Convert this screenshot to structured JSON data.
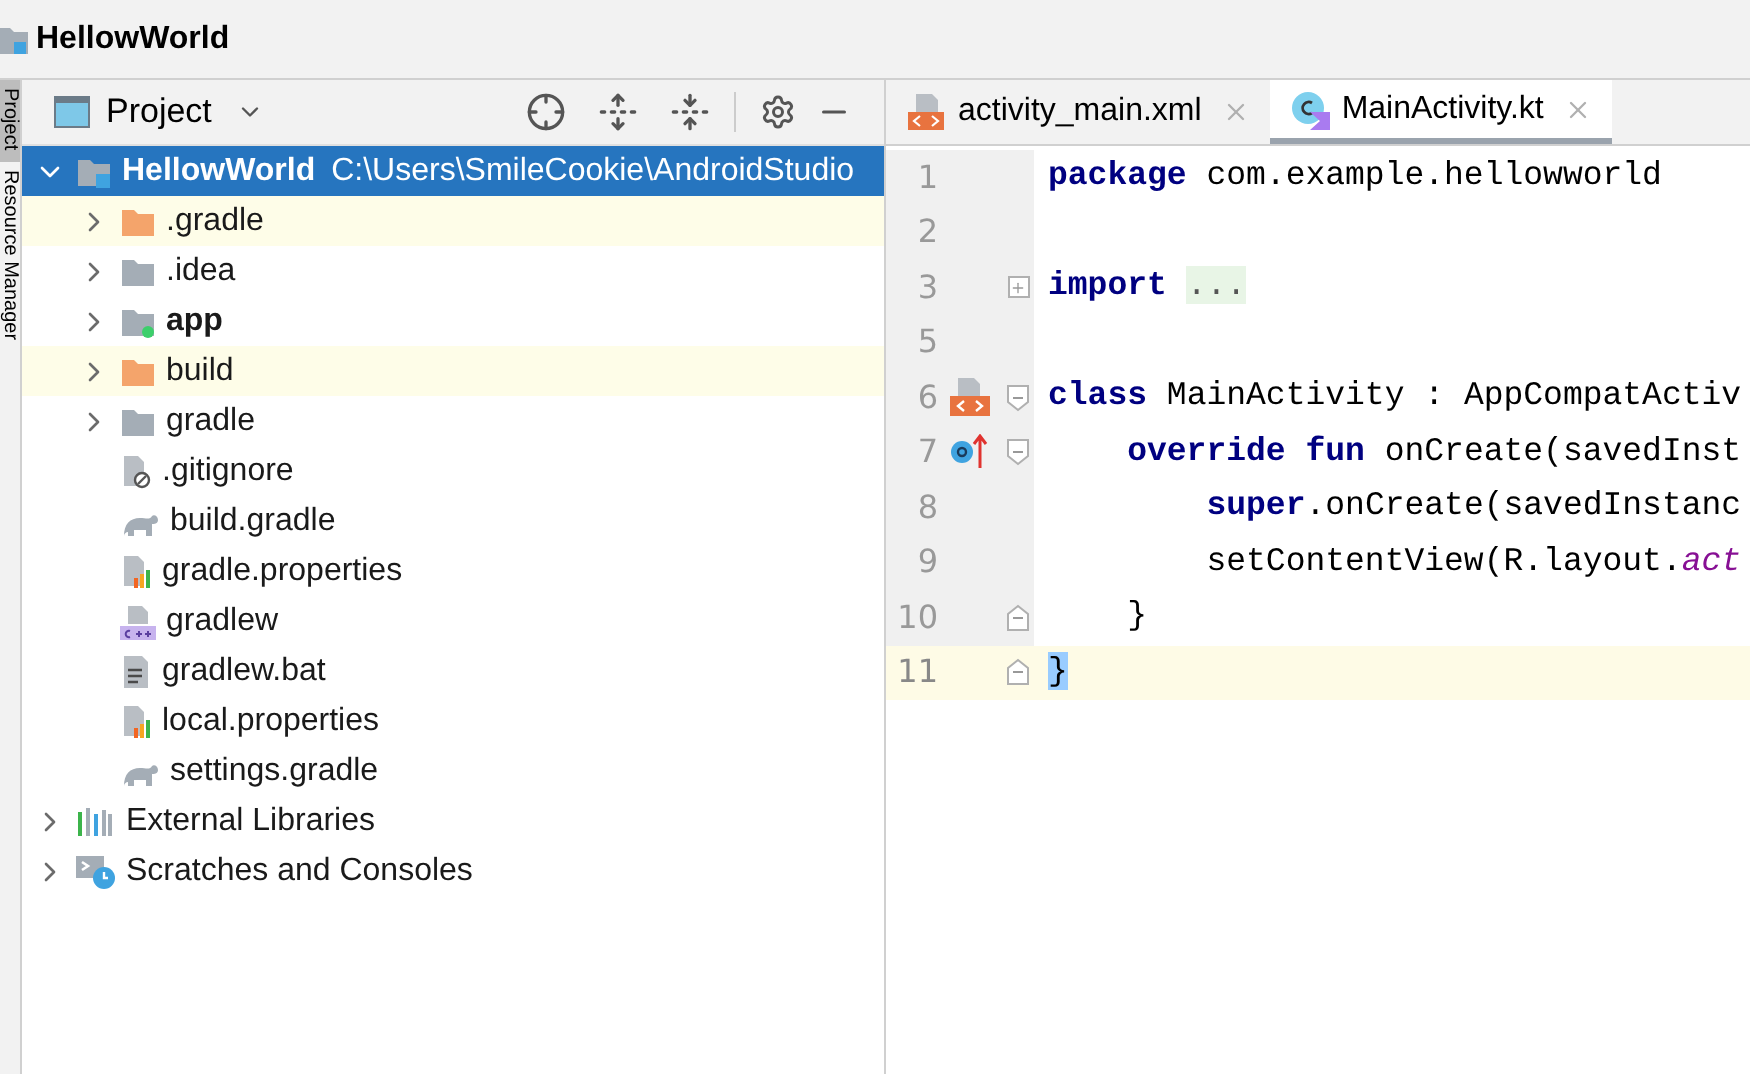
{
  "window": {
    "title": "HellowWorld"
  },
  "side_strip": [
    {
      "label": "Project",
      "selected": true
    },
    {
      "label": "Resource Manager",
      "selected": false
    }
  ],
  "project_panel": {
    "view_selector": "Project",
    "tree": [
      {
        "label": "HellowWorld",
        "detail": "C:\\Users\\SmileCookie\\AndroidStudio",
        "kind": "module",
        "expanded": true,
        "selected": true,
        "bold": true,
        "children": [
          {
            "label": ".gradle",
            "kind": "folder_excluded",
            "expanded": false,
            "selected": false,
            "highlighted": true,
            "bold": false
          },
          {
            "label": ".idea",
            "kind": "folder",
            "expanded": false,
            "selected": false,
            "highlighted": false,
            "bold": false
          },
          {
            "label": "app",
            "kind": "module_folder",
            "expanded": false,
            "selected": false,
            "highlighted": false,
            "bold": true
          },
          {
            "label": "build",
            "kind": "folder_excluded",
            "expanded": false,
            "selected": false,
            "highlighted": true,
            "bold": false
          },
          {
            "label": "gradle",
            "kind": "folder",
            "expanded": false,
            "selected": false,
            "highlighted": false,
            "bold": false
          },
          {
            "label": ".gitignore",
            "kind": "ignore_file",
            "selected": false,
            "highlighted": false,
            "bold": false
          },
          {
            "label": "build.gradle",
            "kind": "gradle_file",
            "selected": false,
            "highlighted": false,
            "bold": false
          },
          {
            "label": "gradle.properties",
            "kind": "properties_file",
            "selected": false,
            "highlighted": false,
            "bold": false
          },
          {
            "label": "gradlew",
            "kind": "script_file",
            "selected": false,
            "highlighted": false,
            "bold": false
          },
          {
            "label": "gradlew.bat",
            "kind": "text_file",
            "selected": false,
            "highlighted": false,
            "bold": false
          },
          {
            "label": "local.properties",
            "kind": "properties_file",
            "selected": false,
            "highlighted": false,
            "bold": false
          },
          {
            "label": "settings.gradle",
            "kind": "gradle_file",
            "selected": false,
            "highlighted": false,
            "bold": false
          }
        ]
      },
      {
        "label": "External Libraries",
        "kind": "libraries",
        "expanded": false,
        "selected": false,
        "highlighted": false,
        "bold": false
      },
      {
        "label": "Scratches and Consoles",
        "kind": "scratches",
        "expanded": false,
        "selected": false,
        "highlighted": false,
        "bold": false
      }
    ]
  },
  "editor": {
    "tabs": [
      {
        "label": "activity_main.xml",
        "kind": "xml",
        "selected": false
      },
      {
        "label": "MainActivity.kt",
        "kind": "kotlin",
        "selected": true
      }
    ],
    "lines": [
      {
        "number": "1",
        "current": false,
        "tokens": [
          {
            "text": "package",
            "kind": "keyword"
          },
          {
            "text": " com.example.hellowworld",
            "kind": "plain"
          }
        ]
      },
      {
        "number": "2",
        "current": false
      },
      {
        "number": "3",
        "current": false,
        "fold": {
          "kind": "expand"
        },
        "tokens": [
          {
            "text": "import",
            "kind": "keyword"
          },
          {
            "text": "...",
            "kind": "folded"
          }
        ]
      },
      {
        "number": "5",
        "current": false
      },
      {
        "number": "6",
        "current": false,
        "fold": {
          "kind": "open"
        },
        "gutter_icon": {
          "kind": "layout"
        },
        "tokens": [
          {
            "text": "class",
            "kind": "keyword"
          },
          {
            "text": " MainActivity : AppCompatActiv",
            "kind": "plain"
          }
        ]
      },
      {
        "number": "7",
        "current": false,
        "fold": {
          "kind": "open"
        },
        "gutter_icon": {
          "kind": "override"
        },
        "tokens": [
          {
            "text": "    override fun",
            "kind": "keyword"
          },
          {
            "text": " onCreate(savedInst",
            "kind": "plain"
          }
        ]
      },
      {
        "number": "8",
        "current": false,
        "tokens": [
          {
            "text": "        super",
            "kind": "keyword"
          },
          {
            "text": ".onCreate(savedInstanc",
            "kind": "plain"
          }
        ]
      },
      {
        "number": "9",
        "current": false,
        "tokens": [
          {
            "text": "        setContentView(R.layout.",
            "kind": "plain"
          },
          {
            "text": "act",
            "kind": "italic"
          }
        ]
      },
      {
        "number": "10",
        "current": false,
        "fold": {
          "kind": "close"
        },
        "tokens": [
          {
            "text": "    }",
            "kind": "plain"
          }
        ]
      },
      {
        "number": "11",
        "current": true,
        "fold": {
          "kind": "close"
        },
        "tokens": [
          {
            "text": "}",
            "kind": "brace_match"
          }
        ]
      }
    ]
  }
}
